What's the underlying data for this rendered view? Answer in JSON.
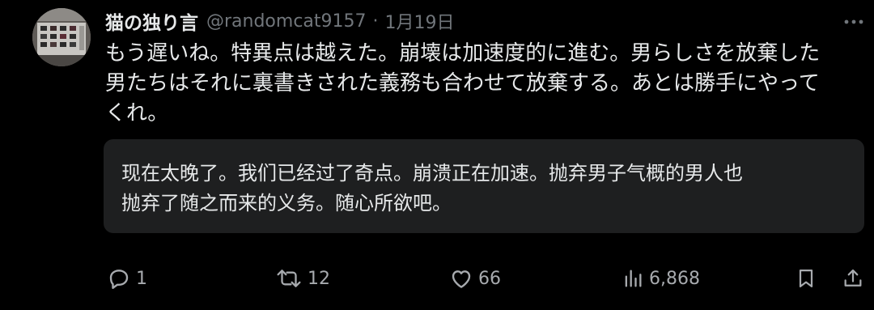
{
  "tweet": {
    "display_name": "猫の独り言",
    "handle": "@randomcat9157",
    "separator": "·",
    "date": "1月19日",
    "text_lines": [
      "もう遅いね。特異点は越えた。崩壊は加速度的に進む。男らしさを放棄した",
      "男たちはそれに裏書きされた義務も合わせて放棄する。あとは勝手にやって",
      "くれ。"
    ],
    "translation_lines": [
      "现在太晚了。我们已经过了奇点。崩溃正在加速。抛弃男子气概的男人也",
      "抛弃了随之而来的义务。随心所欲吧。"
    ]
  },
  "actions": {
    "replies": "1",
    "retweets": "12",
    "likes": "66",
    "views": "6,868"
  },
  "icons": {
    "more": "more-horizontal-icon",
    "reply": "reply-bubble-icon",
    "retweet": "retweet-icon",
    "like": "heart-icon",
    "views": "views-bar-chart-icon",
    "bookmark": "bookmark-icon",
    "share": "share-upload-icon"
  },
  "colors": {
    "background": "#000000",
    "text": "#e7e9ea",
    "muted": "#71767b",
    "translation_bg": "#1e1f20"
  }
}
